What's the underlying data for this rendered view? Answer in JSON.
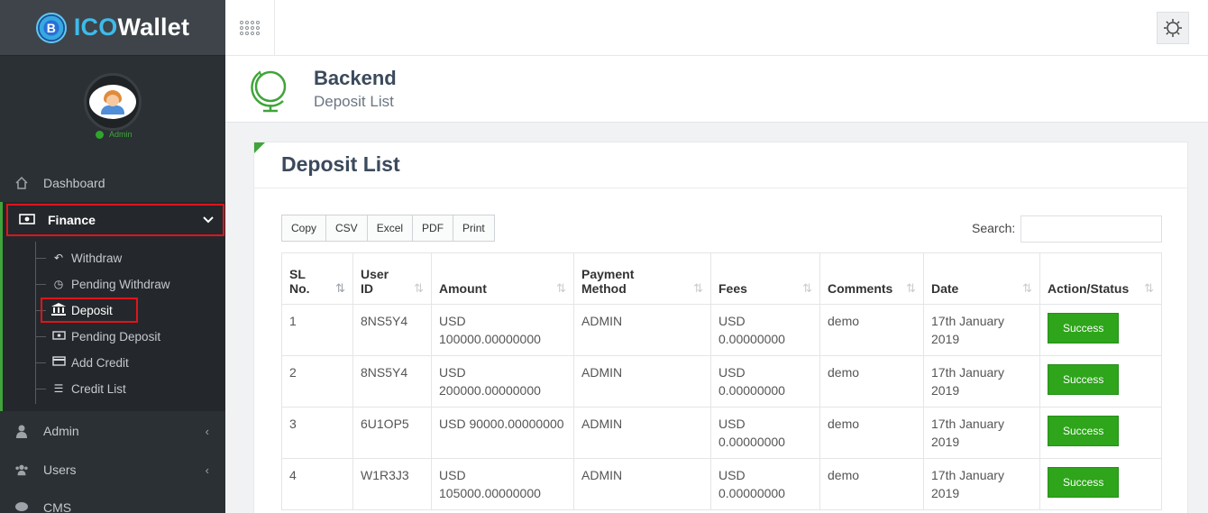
{
  "brand": {
    "prefix": "ICO",
    "suffix": "Wallet",
    "logo_letter": "B"
  },
  "profile": {
    "role": "Admin"
  },
  "sidebar": {
    "dashboard": "Dashboard",
    "finance": "Finance",
    "finance_sub": [
      "Withdraw",
      "Pending Withdraw",
      "Deposit",
      "Pending Deposit",
      "Add Credit",
      "Credit List"
    ],
    "admin": "Admin",
    "users": "Users",
    "cms": "CMS"
  },
  "header": {
    "title": "Backend",
    "subtitle": "Deposit List"
  },
  "card": {
    "title": "Deposit List",
    "export_buttons": [
      "Copy",
      "CSV",
      "Excel",
      "PDF",
      "Print"
    ],
    "search_label": "Search:"
  },
  "table": {
    "columns": [
      "SL No.",
      "User ID",
      "Amount",
      "Payment Method",
      "Fees",
      "Comments",
      "Date",
      "Action/Status"
    ],
    "rows": [
      [
        "1",
        "8NS5Y4",
        "USD 100000.00000000",
        "ADMIN",
        "USD 0.00000000",
        "demo",
        "17th January 2019",
        "Success"
      ],
      [
        "2",
        "8NS5Y4",
        "USD 200000.00000000",
        "ADMIN",
        "USD 0.00000000",
        "demo",
        "17th January 2019",
        "Success"
      ],
      [
        "3",
        "6U1OP5",
        "USD 90000.00000000",
        "ADMIN",
        "USD 0.00000000",
        "demo",
        "17th January 2019",
        "Success"
      ],
      [
        "4",
        "W1R3J3",
        "USD 105000.00000000",
        "ADMIN",
        "USD 0.00000000",
        "demo",
        "17th January 2019",
        "Success"
      ]
    ]
  },
  "colors": {
    "accent": "#3fa53a",
    "sidebar_bg": "#2b3035",
    "highlight_border": "#e0141c",
    "success": "#2ea51b"
  }
}
